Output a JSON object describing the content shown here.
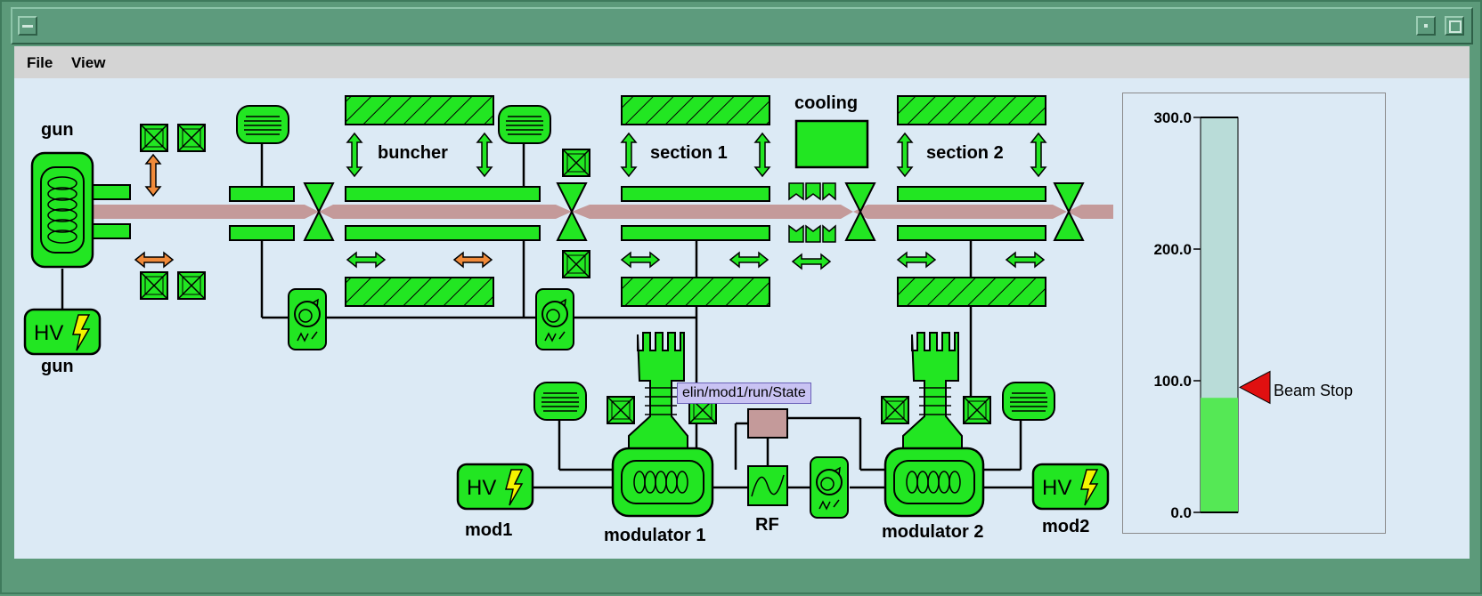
{
  "window": {
    "title": "",
    "menu": [
      "File",
      "View"
    ]
  },
  "labels": {
    "gun_top": "gun",
    "gun_bottom": "gun",
    "buncher": "buncher",
    "section1": "section 1",
    "section2": "section 2",
    "cooling": "cooling",
    "mod1": "mod1",
    "mod2": "mod2",
    "modulator1": "modulator 1",
    "modulator2": "modulator 2",
    "rf": "RF",
    "hv": "HV"
  },
  "tooltip": "elin/mod1/run/State",
  "gauge": {
    "ticks": [
      "300.0",
      "200.0",
      "100.0",
      "0.0"
    ],
    "min": 0,
    "max": 300,
    "value": 87,
    "marker_value": 95,
    "marker_label": "Beam Stop",
    "fill_color": "#55e855",
    "track_color": "#b9dcd8",
    "marker_color": "#e01010"
  },
  "colors": {
    "device": "#22e622",
    "beam": "#c49a9a",
    "orange": "#f08a3a",
    "background": "#dceaf5"
  },
  "icons": [
    "menu-icon",
    "minimize-icon",
    "maximize-icon",
    "lightning-icon",
    "circulator-icon",
    "quadrupole-icon",
    "arrow-icon",
    "valve-icon",
    "coil-icon",
    "sine-wave-icon"
  ]
}
